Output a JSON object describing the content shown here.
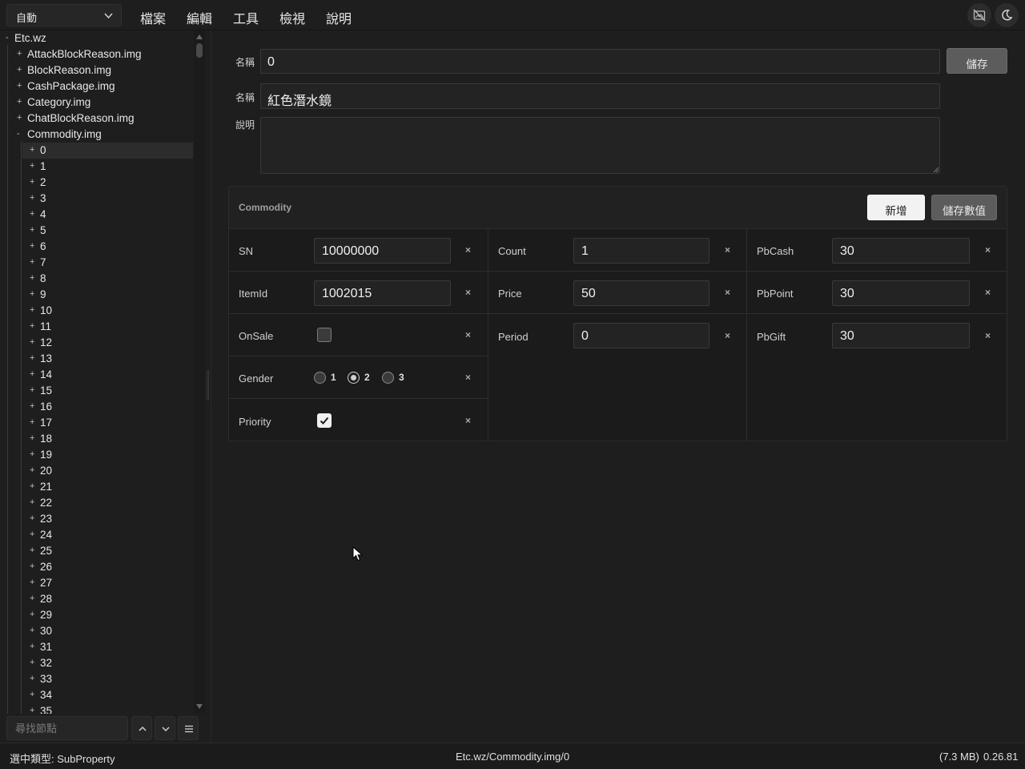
{
  "toolbar": {
    "mode_select": "自動",
    "menu": [
      "檔案",
      "編輯",
      "工具",
      "檢視",
      "說明"
    ],
    "icons": [
      "no-image-icon",
      "moon-icon"
    ]
  },
  "tree": {
    "root": {
      "sign": "-",
      "label": "Etc.wz"
    },
    "files": [
      {
        "sign": "+",
        "label": "AttackBlockReason.img"
      },
      {
        "sign": "+",
        "label": "BlockReason.img"
      },
      {
        "sign": "+",
        "label": "CashPackage.img"
      },
      {
        "sign": "+",
        "label": "Category.img"
      },
      {
        "sign": "+",
        "label": "ChatBlockReason.img"
      },
      {
        "sign": "-",
        "label": "Commodity.img"
      }
    ],
    "children": [
      "0",
      "1",
      "2",
      "3",
      "4",
      "5",
      "6",
      "7",
      "8",
      "9",
      "10",
      "11",
      "12",
      "13",
      "14",
      "15",
      "16",
      "17",
      "18",
      "19",
      "20",
      "21",
      "22",
      "23",
      "24",
      "25",
      "26",
      "27",
      "28",
      "29",
      "30",
      "31",
      "32",
      "33",
      "34",
      "35"
    ],
    "selected": "0"
  },
  "search": {
    "placeholder": "尋找節點"
  },
  "form": {
    "name_label": "名稱",
    "name_value": "0",
    "save_label": "儲存",
    "name2_label": "名稱",
    "name2_value": "紅色潛水鏡",
    "desc_label": "說明",
    "desc_value": ""
  },
  "commodity": {
    "title": "Commodity",
    "add_label": "新增",
    "save_values_label": "儲存數值",
    "remove_glyph": "×",
    "fields": {
      "sn": {
        "label": "SN",
        "value": "10000000"
      },
      "itemid": {
        "label": "ItemId",
        "value": "1002015"
      },
      "onsale": {
        "label": "OnSale",
        "checked": false
      },
      "gender": {
        "label": "Gender",
        "options": [
          "1",
          "2",
          "3"
        ],
        "selected": "2"
      },
      "priority": {
        "label": "Priority",
        "checked": true
      },
      "count": {
        "label": "Count",
        "value": "1"
      },
      "price": {
        "label": "Price",
        "value": "50"
      },
      "period": {
        "label": "Period",
        "value": "0"
      },
      "pbcash": {
        "label": "PbCash",
        "value": "30"
      },
      "pbpoint": {
        "label": "PbPoint",
        "value": "30"
      },
      "pbgift": {
        "label": "PbGift",
        "value": "30"
      }
    }
  },
  "status": {
    "type_text": "選中類型: SubProperty",
    "path": "Etc.wz/Commodity.img/0",
    "size": "(7.3 MB)",
    "version": "0.26.81"
  }
}
